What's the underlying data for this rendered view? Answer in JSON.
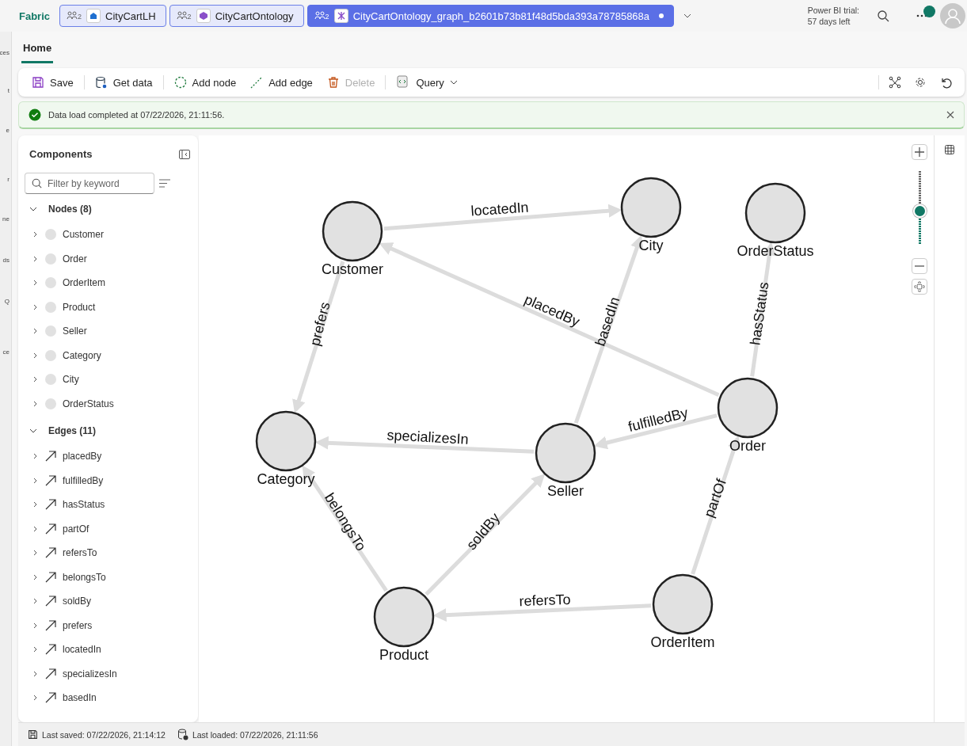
{
  "top_bar": {
    "brand": "Fabric",
    "tabs": [
      {
        "label": "CityCartLH",
        "badge": "2",
        "kind": "lakehouse",
        "selected": false,
        "modified": false
      },
      {
        "label": "CityCartOntology",
        "badge": "2",
        "kind": "ontology",
        "selected": false,
        "modified": false
      },
      {
        "label": "CityCartOntology_graph_b2601b73b81f48d5bda393a78785868a",
        "badge": "2",
        "kind": "graph",
        "selected": true,
        "modified": true
      }
    ],
    "trial": [
      "Power BI trial:",
      "57 days left"
    ],
    "notifications_dot": true
  },
  "left_panel_fragments": [
    "ces",
    "t",
    "e",
    "r",
    "ne",
    "ds",
    "Q",
    "ce"
  ],
  "ribbon_tabs": [
    {
      "label": "Home",
      "selected": true
    }
  ],
  "toolbar": [
    {
      "label": "Save",
      "kind": "save",
      "disabled": false
    },
    {
      "label": "Get data",
      "kind": "get-data",
      "disabled": false
    },
    {
      "label": "Add node",
      "kind": "add-node",
      "disabled": false
    },
    {
      "label": "Add edge",
      "kind": "add-edge",
      "disabled": false
    },
    {
      "label": "Delete",
      "kind": "delete",
      "disabled": true
    },
    {
      "label": "Query",
      "kind": "query",
      "disabled": false
    }
  ],
  "banner": {
    "message": "Data load completed at 07/22/2026, 21:11:56."
  },
  "components": {
    "title": "Components",
    "search": {
      "placeholder": "Filter by keyword"
    },
    "sections": [
      {
        "label": "Nodes (8)",
        "kind": "node",
        "expanded": true,
        "items": [
          {
            "label": "Customer",
            "expanded": false
          },
          {
            "label": "Order",
            "expanded": false
          },
          {
            "label": "OrderItem",
            "expanded": false
          },
          {
            "label": "Product",
            "expanded": false
          },
          {
            "label": "Seller",
            "expanded": false
          },
          {
            "label": "Category",
            "expanded": false
          },
          {
            "label": "City",
            "expanded": false
          },
          {
            "label": "OrderStatus",
            "expanded": false
          }
        ]
      },
      {
        "label": "Edges (11)",
        "kind": "edge",
        "expanded": true,
        "items": [
          {
            "label": "placedBy",
            "expanded": false
          },
          {
            "label": "fulfilledBy",
            "expanded": false
          },
          {
            "label": "hasStatus",
            "expanded": false
          },
          {
            "label": "partOf",
            "expanded": false
          },
          {
            "label": "refersTo",
            "expanded": false
          },
          {
            "label": "belongsTo",
            "expanded": false
          },
          {
            "label": "soldBy",
            "expanded": false
          },
          {
            "label": "prefers",
            "expanded": false
          },
          {
            "label": "locatedIn",
            "expanded": false
          },
          {
            "label": "specializesIn",
            "expanded": false
          },
          {
            "label": "basedIn",
            "expanded": false
          }
        ]
      }
    ]
  },
  "graph": {
    "nodes": [
      "Customer",
      "Order",
      "OrderItem",
      "Product",
      "Seller",
      "Category",
      "City",
      "OrderStatus"
    ],
    "edges": [
      "placedBy",
      "fulfilledBy",
      "hasStatus",
      "partOf",
      "refersTo",
      "belongsTo",
      "soldBy",
      "prefers",
      "locatedIn",
      "specializesIn",
      "basedIn"
    ],
    "zoom": {
      "level": 0.45
    }
  },
  "status_bar": {
    "last_saved": "Last saved: 07/22/2026, 21:14:12",
    "last_loaded": "Last loaded: 07/22/2026, 21:11:56"
  }
}
